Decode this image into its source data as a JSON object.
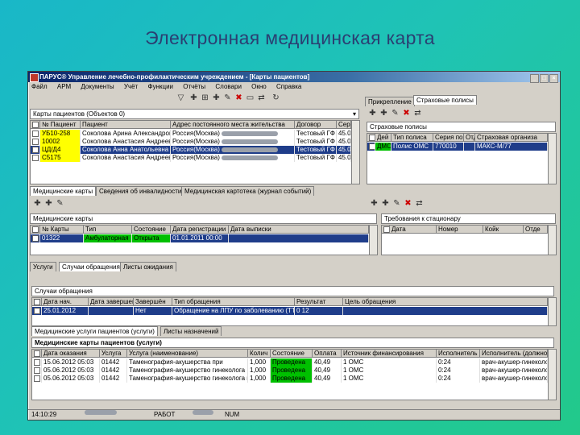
{
  "slide": {
    "title": "Электронная медицинская карта"
  },
  "window": {
    "title": "ПАРУС® Управление лечебно-профилактическим учреждением - [Карты пациентов]",
    "menu": [
      "Файл",
      "АРМ",
      "Документы",
      "Учёт",
      "Функции",
      "Отчёты",
      "Словари",
      "Окно",
      "Справка"
    ]
  },
  "patients_pane": {
    "header": "Карты пациентов (Объектов 0)",
    "columns": [
      "№ Пациент",
      "Пациент",
      "Адрес постоянного места жительства",
      "Договор",
      "Сер"
    ],
    "rows": [
      {
        "num": "УБ10-258",
        "name": "Соколова Арина Александровна",
        "address": "Россия(Москва)",
        "contract": "Тестовый ГФ",
        "ser": "45.0"
      },
      {
        "num": "10002",
        "name": "Соколова Анастасия Андреевна",
        "address": "Россия(Москва)",
        "contract": "Тестовый ГФ",
        "ser": "45.0"
      },
      {
        "num": "ЦД/Д4",
        "name": "Соколова Анна Анатольевна",
        "address": "Россия(Москва)",
        "contract": "Тестовый ГФ",
        "ser": "45.0"
      },
      {
        "num": "С5175",
        "name": "Соколова Анастасия Андреевна",
        "address": "Россия(Москва)",
        "contract": "Тестовый ГФ",
        "ser": "45.0"
      }
    ]
  },
  "right_top": {
    "tabs": [
      "Прикрепление",
      "Страховые полисы"
    ],
    "header": "Страховые полисы",
    "columns": [
      "Дей",
      "Тип полиса",
      "Серия по",
      "Отд",
      "Страховая организа"
    ],
    "row": {
      "type": "ДМС",
      "kind": "Полис ОМС",
      "ser": "770010",
      "org": "МАКС-М/77"
    }
  },
  "middle_tabs": [
    "Медицинские карты",
    "Сведения об инвалидности",
    "Медицинская картотека (журнал событий)"
  ],
  "med_cards": {
    "header": "Медицинские карты",
    "columns": [
      "№ Карты",
      "Тип",
      "Состояние",
      "Дата регистрации",
      "Дата выписки"
    ],
    "row": {
      "num": "01322",
      "type": "Амбулаторная",
      "state": "Открыта",
      "reg": "01.01.2011 00:00",
      "out": ""
    }
  },
  "stationary": {
    "header": "Требования к стационару",
    "columns": [
      "Дата",
      "Номер",
      "Койк",
      "Отде"
    ]
  },
  "lower_tabs": [
    "Услуги",
    "Случаи обращения",
    "Листы ожидания"
  ],
  "cases": {
    "header": "Случаи обращения",
    "columns": [
      "Дата нач.",
      "Дата завершения",
      "Завершён",
      "Тип обращения",
      "Результат",
      "Цель обращения"
    ],
    "row": {
      "start": "25.01.2012",
      "end": "",
      "done": "Нет",
      "type": "Обращение на ЛПУ по заболеванию (ТТОС)",
      "result": "0 12",
      "goal": ""
    }
  },
  "bottom_tabs": [
    "Медицинские услуги пациентов (услуги)",
    "Листы назначений"
  ],
  "services": {
    "header": "Медицинские карты пациентов (услуги)",
    "columns": [
      "Дата оказания",
      "Услуга",
      "Услуга (наименование)",
      "Колич",
      "Состояние",
      "Оплата",
      "Источник финансирования",
      "Исполнитель",
      "Исполнитель (должно"
    ],
    "rows": [
      {
        "date": "15.06.2012 05:03",
        "code": "01442",
        "name": "Таменография-акушерства при",
        "qty": "1,000",
        "state": "Проведена",
        "pay": "40,49",
        "src": "1 ОМС",
        "exec": "0:24",
        "pos": "врач-акушер-гинеколог"
      },
      {
        "date": "05.06.2012 05:03",
        "code": "01442",
        "name": "Таменография-акушерство гинеколога",
        "qty": "1,000",
        "state": "Проведена",
        "pay": "40,49",
        "src": "1 ОМС",
        "exec": "0:24",
        "pos": "врач-акушер-гинеколог"
      },
      {
        "date": "05.06.2012 05:03",
        "code": "01442",
        "name": "Таменография-акушерство гинеколога при",
        "qty": "1,000",
        "state": "Проведена",
        "pay": "40,49",
        "src": "1 ОМС",
        "exec": "0:24",
        "pos": "врач-акушер-гинеколог"
      }
    ]
  },
  "status": {
    "time": "14:10:29",
    "mode": "РАБОТ",
    "num": "NUM"
  }
}
